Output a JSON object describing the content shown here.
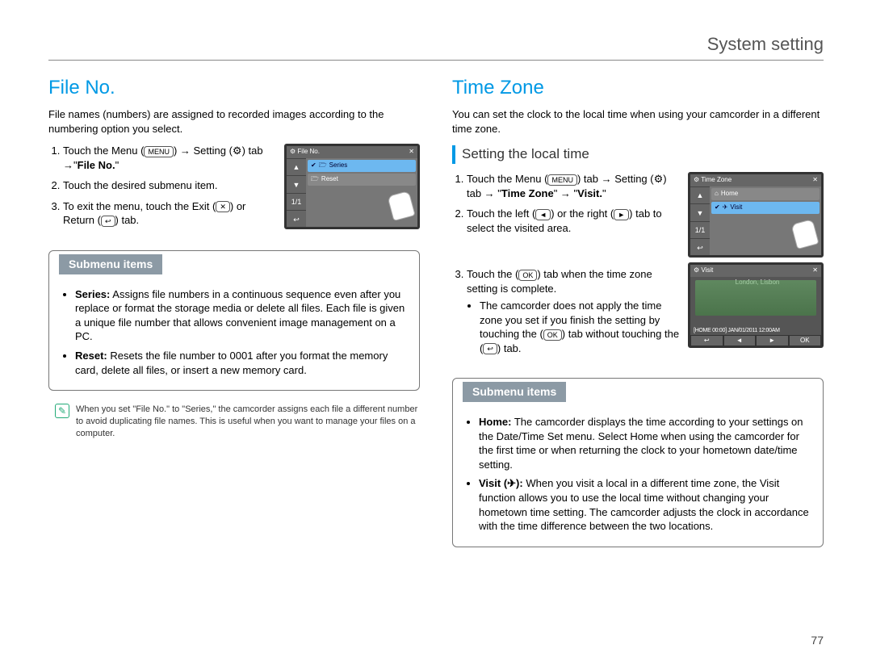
{
  "header": "System setting",
  "page_number": "77",
  "left": {
    "title": "File No.",
    "intro": "File names (numbers) are assigned to recorded images according to the numbering option you select.",
    "steps": [
      {
        "pre": "Touch the Menu (",
        "mid1": ") → Setting (",
        "mid2": ") tab →\"",
        "bold": "File No.",
        "post": "\""
      },
      {
        "text": "Touch the desired submenu item."
      },
      {
        "pre": "To exit the menu, touch the Exit (",
        "mid1": ") or Return (",
        "post": ") tab."
      }
    ],
    "screen": {
      "title": "File No.",
      "rows": [
        "Series",
        "Reset"
      ],
      "page": "1/1"
    },
    "submenu_title": "Submenu items",
    "submenu": [
      {
        "label": "Series:",
        "text": "Assigns file numbers in a continuous sequence even after you replace or format the storage media or delete all files. Each file is given a unique file number that allows convenient image management on a PC."
      },
      {
        "label": "Reset:",
        "text": "Resets the file number to 0001 after you format the memory card,  delete all files, or insert a new memory card."
      }
    ],
    "note": "When you set \"File No.\" to \"Series,\" the camcorder assigns each file a different number to avoid duplicating file names. This is useful when you want to manage your files on a computer."
  },
  "right": {
    "title": "Time Zone",
    "intro": "You can set the clock to the local time when using your camcorder in a different time zone.",
    "subhead": "Setting the local time",
    "steps": [
      {
        "pre": "Touch the Menu (",
        "mid1": ") tab → Setting (",
        "mid2": ") tab → \"",
        "bold1": "Time Zone",
        "mid3": "\" → \"",
        "bold2": "Visit.",
        "post": "\""
      },
      {
        "pre": "Touch the left (",
        "mid1": ") or the right (",
        "post": ") tab to select the visited area."
      },
      {
        "pre": "Touch the (",
        "mid1": ") tab when the time zone setting is complete.",
        "sub_pre": "The camcorder does not apply the time zone you set if you finish the setting by touching the (",
        "sub_mid": ") tab without touching the (",
        "sub_post": ") tab."
      }
    ],
    "screen1": {
      "title": "Time Zone",
      "rows": [
        "Home",
        "Visit"
      ],
      "page": "1/1"
    },
    "screen2": {
      "title": "Visit",
      "city": "London, Lisbon",
      "status": "[HOME 00:00] JAN/01/2011 12:00AM"
    },
    "submenu_title": "Submenu items",
    "submenu": [
      {
        "label": "Home:",
        "text": "The camcorder displays the time according to your settings on the Date/Time Set menu. Select Home when using the camcorder for the first time or when returning the clock to your hometown date/time setting."
      },
      {
        "label": "Visit (✈):",
        "text": "When you visit a local in a different time zone, the Visit function allows you to use the local time without changing your hometown time setting. The camcorder adjusts the clock in accordance with the time difference between the two locations."
      }
    ]
  },
  "icons": {
    "menu": "MENU",
    "gear": "⚙",
    "x": "✕",
    "return": "↩",
    "left": "◄",
    "right": "►",
    "ok": "OK",
    "check": "✔",
    "home": "⌂",
    "plane": "✈",
    "up": "▲",
    "down": "▼"
  }
}
